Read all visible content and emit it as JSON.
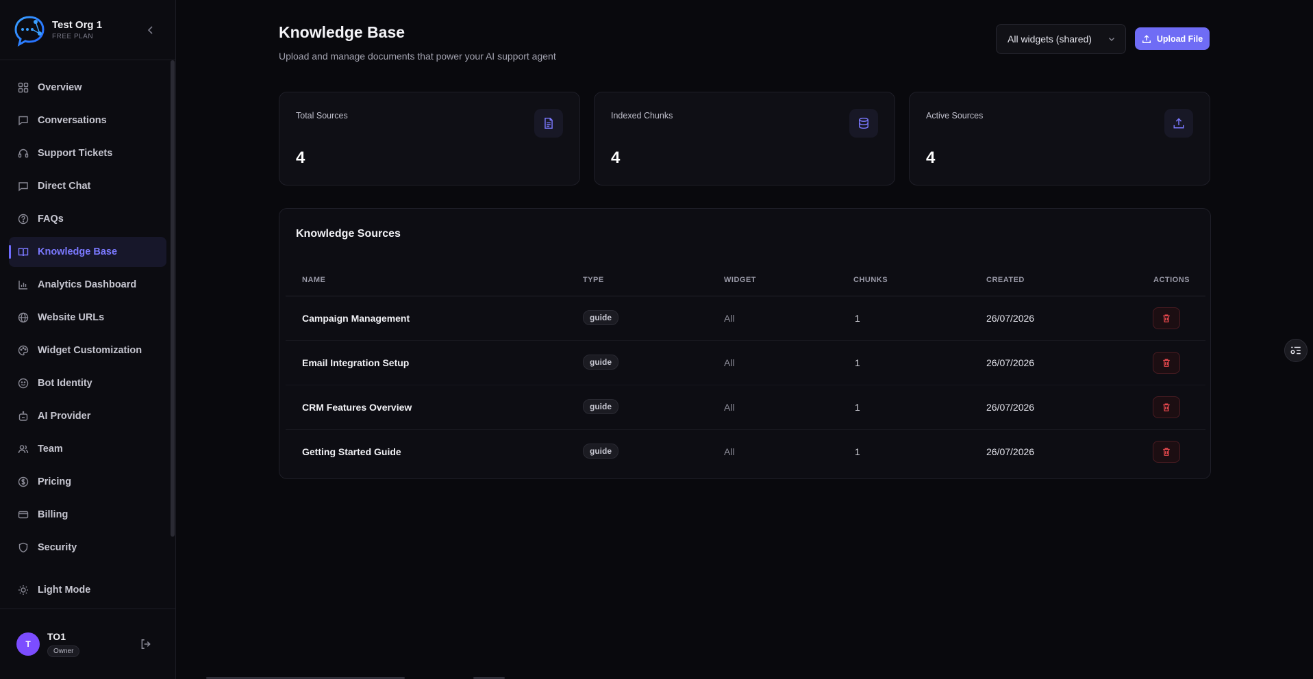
{
  "org": {
    "name": "Test Org 1",
    "plan": "FREE PLAN"
  },
  "nav": {
    "items": [
      {
        "label": "Overview",
        "icon": "grid-icon"
      },
      {
        "label": "Conversations",
        "icon": "chat-icon"
      },
      {
        "label": "Support Tickets",
        "icon": "headset-icon"
      },
      {
        "label": "Direct Chat",
        "icon": "message-icon"
      },
      {
        "label": "FAQs",
        "icon": "help-circle-icon"
      },
      {
        "label": "Knowledge Base",
        "icon": "book-icon",
        "active": true
      },
      {
        "label": "Analytics Dashboard",
        "icon": "bar-chart-icon"
      },
      {
        "label": "Website URLs",
        "icon": "globe-icon"
      },
      {
        "label": "Widget Customization",
        "icon": "palette-icon"
      },
      {
        "label": "Bot Identity",
        "icon": "smile-icon"
      },
      {
        "label": "AI Provider",
        "icon": "bot-icon"
      },
      {
        "label": "Team",
        "icon": "users-icon"
      },
      {
        "label": "Pricing",
        "icon": "dollar-icon"
      },
      {
        "label": "Billing",
        "icon": "card-icon"
      },
      {
        "label": "Security",
        "icon": "shield-icon"
      }
    ],
    "theme_toggle": "Light Mode"
  },
  "user": {
    "initial": "T",
    "name": "TO1",
    "role": "Owner"
  },
  "page": {
    "title": "Knowledge Base",
    "subtitle": "Upload and manage documents that power your AI support agent",
    "widget_select": "All widgets (shared)",
    "upload_label": "Upload File"
  },
  "stats": [
    {
      "label": "Total Sources",
      "value": "4",
      "icon": "document-icon"
    },
    {
      "label": "Indexed Chunks",
      "value": "4",
      "icon": "database-icon"
    },
    {
      "label": "Active Sources",
      "value": "4",
      "icon": "upload-icon"
    }
  ],
  "sources": {
    "title": "Knowledge Sources",
    "columns": [
      "NAME",
      "TYPE",
      "WIDGET",
      "CHUNKS",
      "CREATED",
      "ACTIONS"
    ],
    "rows": [
      {
        "name": "Campaign Management",
        "type": "guide",
        "widget": "All",
        "chunks": "1",
        "created": "26/07/2026"
      },
      {
        "name": "Email Integration Setup",
        "type": "guide",
        "widget": "All",
        "chunks": "1",
        "created": "26/07/2026"
      },
      {
        "name": "CRM Features Overview",
        "type": "guide",
        "widget": "All",
        "chunks": "1",
        "created": "26/07/2026"
      },
      {
        "name": "Getting Started Guide",
        "type": "guide",
        "widget": "All",
        "chunks": "1",
        "created": "26/07/2026"
      }
    ]
  },
  "colors": {
    "accent": "#6f6cf5",
    "danger": "#e5484d",
    "background": "#09090d"
  }
}
